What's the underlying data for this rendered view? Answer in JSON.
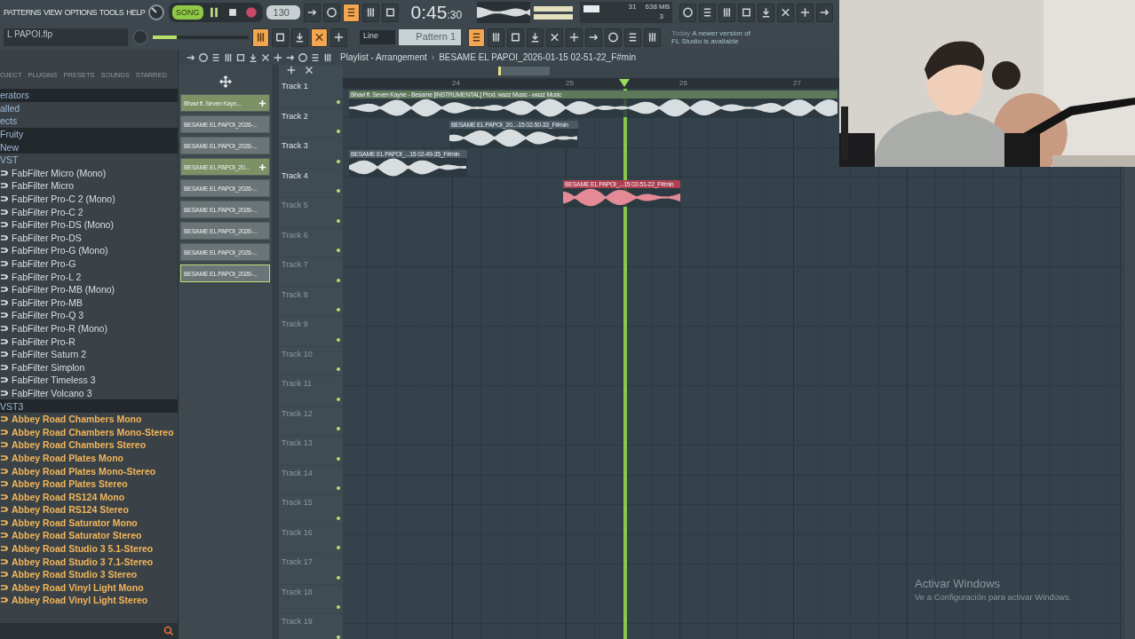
{
  "menu": [
    "PATTERNS",
    "VIEW",
    "OPTIONS",
    "TOOLS",
    "HELP"
  ],
  "transport": {
    "mode_label": "SONG",
    "song_mode": true
  },
  "tempo": "130",
  "time": {
    "main": "0:45",
    "sub": ":30"
  },
  "cpu": {
    "cpu": "31",
    "memory": "638 MB",
    "polyphony": "3"
  },
  "tools_top": [
    {
      "on": false
    },
    {
      "on": false
    },
    {
      "on": true
    },
    {
      "on": false
    },
    {
      "on": false
    }
  ],
  "tools_right": [
    {
      "on": false
    },
    {
      "on": false
    },
    {
      "on": false
    },
    {
      "on": false
    },
    {
      "on": false
    },
    {
      "on": false
    },
    {
      "on": false
    },
    {
      "on": false
    }
  ],
  "file_name": "L PAPOI.flp",
  "master_volume": {
    "level": 0.25
  },
  "tools_bottom": [
    {
      "on": true
    },
    {
      "on": false
    },
    {
      "on": false
    },
    {
      "on": true
    },
    {
      "on": false
    }
  ],
  "snap": "Line",
  "pattern": "Pattern 1",
  "tools_windows": [
    {
      "on": true
    },
    {
      "on": false
    },
    {
      "on": false
    },
    {
      "on": false
    },
    {
      "on": false
    },
    {
      "on": false
    },
    {
      "on": false
    },
    {
      "on": false
    },
    {
      "on": false
    },
    {
      "on": false
    }
  ],
  "hint": {
    "lead": "Today",
    "text": "A newer version of FL Studio is available"
  },
  "browser": {
    "tabs": [
      {
        "label": "OJECT",
        "selected": false
      },
      {
        "label": "PLUGINS",
        "selected": false
      },
      {
        "label": "PRESETS",
        "selected": false
      },
      {
        "label": "SOUNDS",
        "selected": false
      },
      {
        "label": "STARRED",
        "selected": false
      }
    ],
    "items": [
      {
        "label": "erators",
        "kind": "folder",
        "highlighted": true
      },
      {
        "label": "alled",
        "kind": "folder",
        "highlighted": false
      },
      {
        "label": "ects",
        "kind": "folder",
        "highlighted": false
      },
      {
        "label": "Fruity",
        "kind": "folder",
        "highlighted": true
      },
      {
        "label": "New",
        "kind": "folder",
        "highlighted": true
      },
      {
        "label": "VST",
        "kind": "folder",
        "highlighted": false
      },
      {
        "label": "FabFilter Micro (Mono)",
        "kind": "plugin",
        "highlighted": false
      },
      {
        "label": "FabFilter Micro",
        "kind": "plugin",
        "highlighted": false
      },
      {
        "label": "FabFilter Pro-C 2 (Mono)",
        "kind": "plugin",
        "highlighted": false
      },
      {
        "label": "FabFilter Pro-C 2",
        "kind": "plugin",
        "highlighted": false
      },
      {
        "label": "FabFilter Pro-DS (Mono)",
        "kind": "plugin",
        "highlighted": false
      },
      {
        "label": "FabFilter Pro-DS",
        "kind": "plugin",
        "highlighted": false
      },
      {
        "label": "FabFilter Pro-G (Mono)",
        "kind": "plugin",
        "highlighted": false
      },
      {
        "label": "FabFilter Pro-G",
        "kind": "plugin",
        "highlighted": false
      },
      {
        "label": "FabFilter Pro-L 2",
        "kind": "plugin",
        "highlighted": false
      },
      {
        "label": "FabFilter Pro-MB (Mono)",
        "kind": "plugin",
        "highlighted": false
      },
      {
        "label": "FabFilter Pro-MB",
        "kind": "plugin",
        "highlighted": false
      },
      {
        "label": "FabFilter Pro-Q 3",
        "kind": "plugin",
        "highlighted": false
      },
      {
        "label": "FabFilter Pro-R (Mono)",
        "kind": "plugin",
        "highlighted": false
      },
      {
        "label": "FabFilter Pro-R",
        "kind": "plugin",
        "highlighted": false
      },
      {
        "label": "FabFilter Saturn 2",
        "kind": "plugin",
        "highlighted": false
      },
      {
        "label": "FabFilter Simplon",
        "kind": "plugin",
        "highlighted": false
      },
      {
        "label": "FabFilter Timeless 3",
        "kind": "plugin",
        "highlighted": false
      },
      {
        "label": "FabFilter Volcano 3",
        "kind": "plugin",
        "highlighted": false
      },
      {
        "label": "VST3",
        "kind": "folder",
        "highlighted": true
      },
      {
        "label": "Abbey Road Chambers Mono",
        "kind": "vst3",
        "highlighted": false
      },
      {
        "label": "Abbey Road Chambers Mono-Stereo",
        "kind": "vst3",
        "highlighted": false
      },
      {
        "label": "Abbey Road Chambers Stereo",
        "kind": "vst3",
        "highlighted": false
      },
      {
        "label": "Abbey Road Plates Mono",
        "kind": "vst3",
        "highlighted": false
      },
      {
        "label": "Abbey Road Plates Mono-Stereo",
        "kind": "vst3",
        "highlighted": false
      },
      {
        "label": "Abbey Road Plates Stereo",
        "kind": "vst3",
        "highlighted": false
      },
      {
        "label": "Abbey Road RS124 Mono",
        "kind": "vst3",
        "highlighted": false
      },
      {
        "label": "Abbey Road RS124 Stereo",
        "kind": "vst3",
        "highlighted": false
      },
      {
        "label": "Abbey Road Saturator Mono",
        "kind": "vst3",
        "highlighted": false
      },
      {
        "label": "Abbey Road Saturator Stereo",
        "kind": "vst3",
        "highlighted": false
      },
      {
        "label": "Abbey Road Studio 3 5.1-Stereo",
        "kind": "vst3",
        "highlighted": false
      },
      {
        "label": "Abbey Road Studio 3 7.1-Stereo",
        "kind": "vst3",
        "highlighted": false
      },
      {
        "label": "Abbey Road Studio 3 Stereo",
        "kind": "vst3",
        "highlighted": false
      },
      {
        "label": "Abbey Road Vinyl Light Mono",
        "kind": "vst3",
        "highlighted": false
      },
      {
        "label": "Abbey Road Vinyl Light Stereo",
        "kind": "vst3",
        "highlighted": false
      }
    ]
  },
  "playlist": {
    "title": "Playlist - Arrangement",
    "separator": "›",
    "arrangement": "BESAME EL PAPOI_2026-01-15 02-51-22_F#min",
    "ruler": [
      "24",
      "25",
      "26",
      "27"
    ],
    "patterns": [
      {
        "label": "Bhavi ft. Seven Kayn...",
        "active": true,
        "selected": false
      },
      {
        "label": "BESAME EL PAPOI_2026-...",
        "active": false,
        "selected": false
      },
      {
        "label": "BESAME EL PAPOI_2026-...",
        "active": false,
        "selected": false
      },
      {
        "label": "BESAME EL PAPOI_20...",
        "active": true,
        "selected": false
      },
      {
        "label": "BESAME EL PAPOI_2026-...",
        "active": false,
        "selected": false
      },
      {
        "label": "BESAME EL PAPOI_2026-...",
        "active": false,
        "selected": false
      },
      {
        "label": "BESAME EL PAPOI_2026-...",
        "active": false,
        "selected": false
      },
      {
        "label": "BESAME EL PAPOI_2026-...",
        "active": false,
        "selected": false
      },
      {
        "label": "BESAME EL PAPOI_2026-...",
        "active": false,
        "selected": true
      }
    ],
    "tracks": [
      {
        "name": "Track 1",
        "used": true
      },
      {
        "name": "Track 2",
        "used": true
      },
      {
        "name": "Track 3",
        "used": true
      },
      {
        "name": "Track 4",
        "used": true
      },
      {
        "name": "Track 5",
        "used": false
      },
      {
        "name": "Track 6",
        "used": false
      },
      {
        "name": "Track 7",
        "used": false
      },
      {
        "name": "Track 8",
        "used": false
      },
      {
        "name": "Track 9",
        "used": false
      },
      {
        "name": "Track 10",
        "used": false
      },
      {
        "name": "Track 11",
        "used": false
      },
      {
        "name": "Track 12",
        "used": false
      },
      {
        "name": "Track 13",
        "used": false
      },
      {
        "name": "Track 14",
        "used": false
      },
      {
        "name": "Track 15",
        "used": false
      },
      {
        "name": "Track 16",
        "used": false
      },
      {
        "name": "Track 17",
        "used": false
      },
      {
        "name": "Track 18",
        "used": false
      },
      {
        "name": "Track 19",
        "used": false
      }
    ],
    "clips": [
      {
        "label": "Bhavi ft. Seven Kayne - Besame [INSTRUMENTAL]  Prod. wazz Music - wazz Music",
        "color": "#5f7a5a"
      },
      {
        "label": "BESAME EL PAPOI_20...-15 02-50-33_F#min",
        "color": "#4c5a61"
      },
      {
        "label": "BESAME EL PAPOI_...15 02-49-35_F#min",
        "color": "#4c5a61"
      },
      {
        "label": "BESAME EL PAPOI_...15 02-51-22_F#min",
        "color": "#b0404e"
      }
    ]
  },
  "activation": {
    "title": "Activar Windows",
    "text": "Ve a Configuración para activar Windows."
  }
}
